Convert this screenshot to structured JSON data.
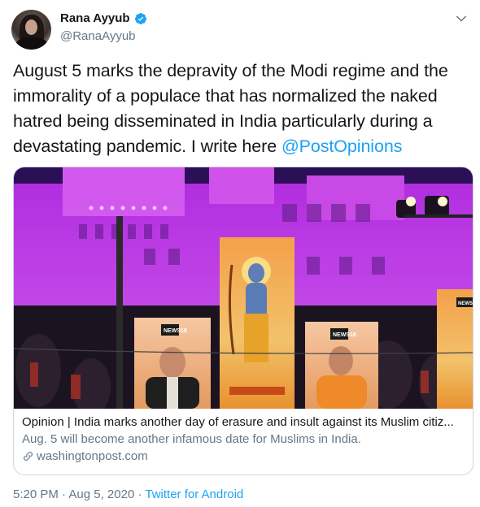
{
  "author": {
    "name": "Rana Ayyub",
    "handle": "@RanaAyyub"
  },
  "tweet": {
    "text": "August 5 marks the depravity of the Modi regime and the immorality of a populace that has normalized the naked hatred being disseminated in India particularly during a devastating pandemic. I write here ",
    "mention": "@PostOpinions"
  },
  "card": {
    "title": "Opinion | India marks another day of erasure and insult against its Muslim citiz...",
    "description": "Aug. 5 will become another infamous date for Muslims in India.",
    "domain": "washingtonpost.com",
    "image_labels": {
      "sign_left": "NEWS18",
      "sign_right": "NEWS18",
      "sign_edge": "NEWS"
    }
  },
  "meta": {
    "time": "5:20 PM",
    "separator1": " · ",
    "date": "Aug 5, 2020",
    "separator2": " · ",
    "source": "Twitter for Android"
  },
  "colors": {
    "accent": "#1da1f2",
    "text": "#14171a",
    "secondary": "#657786",
    "border": "#ccd6dd"
  },
  "icons": [
    "verified-badge-icon",
    "chevron-down-icon",
    "link-icon"
  ]
}
